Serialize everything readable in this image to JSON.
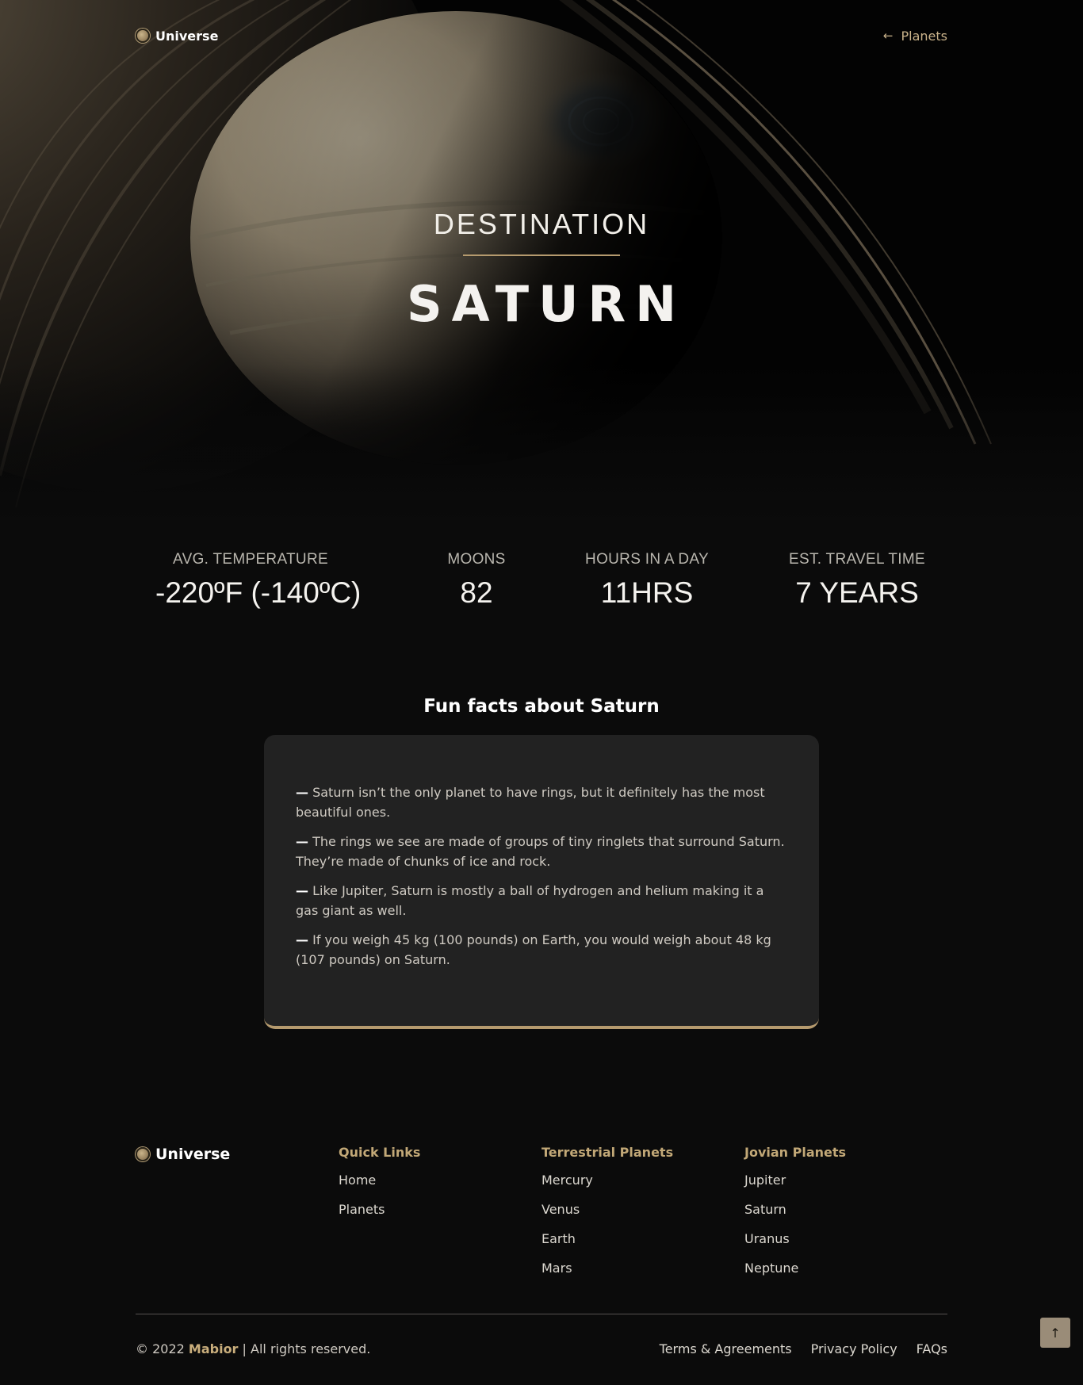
{
  "nav": {
    "brand": "Universe",
    "back_label": "Planets",
    "back_icon": "arrow-left-icon"
  },
  "hero": {
    "kicker": "DESTINATION",
    "planet": "SATURN"
  },
  "stats": [
    {
      "label": "AVG. TEMPERATURE",
      "value": "-220ºF (-140ºC)"
    },
    {
      "label": "MOONS",
      "value": "82"
    },
    {
      "label": "HOURS IN A DAY",
      "value": "11HRS"
    },
    {
      "label": "EST. TRAVEL TIME",
      "value": "7 YEARS"
    }
  ],
  "facts": {
    "title": "Fun facts about Saturn",
    "dash": "—",
    "items": [
      "Saturn isn’t the only planet to have rings, but it definitely has the most beautiful ones.",
      "The rings we see are made of groups of tiny ringlets that surround Saturn. They’re made of chunks of ice and rock.",
      "Like Jupiter, Saturn is mostly a ball of hydrogen and helium making it a gas giant as well.",
      "If you weigh 45 kg (100 pounds) on Earth, you would weigh about 48 kg (107 pounds) on Saturn."
    ]
  },
  "footer": {
    "brand": "Universe",
    "quick_links": {
      "title": "Quick Links",
      "links": [
        "Home",
        "Planets"
      ]
    },
    "terrestrial": {
      "title": "Terrestrial Planets",
      "links": [
        "Mercury",
        "Venus",
        "Earth",
        "Mars"
      ]
    },
    "jovian": {
      "title": "Jovian Planets",
      "links": [
        "Jupiter",
        "Saturn",
        "Uranus",
        "Neptune"
      ]
    },
    "copyright_prefix": "© 2022",
    "company": "Mabior",
    "copyright_suffix": "| All rights reserved.",
    "legal": [
      "Terms & Agreements",
      "Privacy Policy",
      "FAQs"
    ],
    "to_top_icon": "arrow-up-icon",
    "to_top_glyph": "↑"
  },
  "colors": {
    "accent": "#b59a6e",
    "background": "#0b0b0b",
    "card": "#222222"
  }
}
